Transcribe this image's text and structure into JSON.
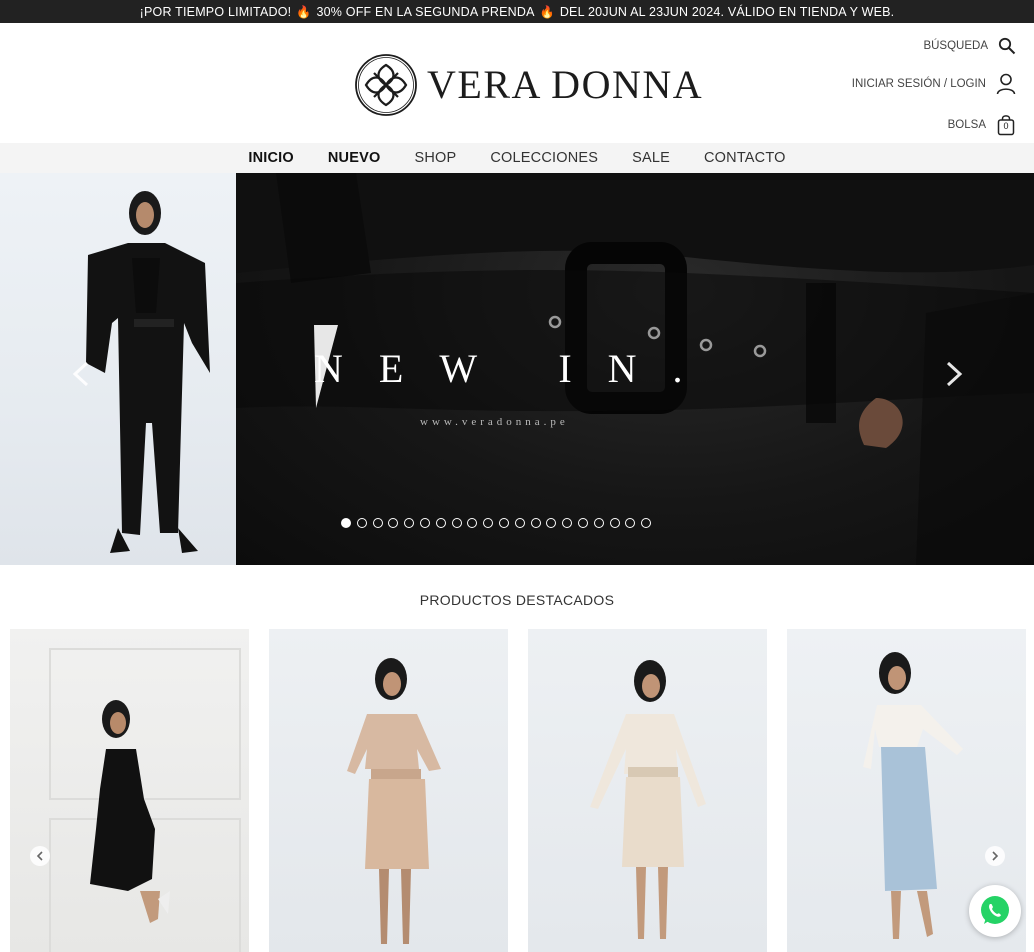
{
  "announcement": {
    "part1": "¡POR TIEMPO LIMITADO!",
    "part2": "30% OFF EN LA SEGUNDA PRENDA",
    "part3": "DEL 20JUN AL 23JUN 2024. VÁLIDO EN TIENDA Y WEB.",
    "flame_icon": "flame-icon",
    "flame_color": "#ff7a1a"
  },
  "header": {
    "brand": "VERA DONNA",
    "search_label": "BÚSQUEDA",
    "login_label": "INICIAR SESIÓN / LOGIN",
    "bag_label": "BOLSA",
    "bag_count": "0"
  },
  "nav": {
    "items": [
      {
        "label": "INICIO"
      },
      {
        "label": "NUEVO"
      },
      {
        "label": "SHOP"
      },
      {
        "label": "COLECCIONES"
      },
      {
        "label": "SALE"
      },
      {
        "label": "CONTACTO"
      }
    ]
  },
  "hero": {
    "title": "NEW IN.",
    "url": "www.veradonna.pe",
    "slide_count": 20,
    "active_slide": 1
  },
  "featured": {
    "title": "PRODUCTOS DESTACADOS",
    "products": [
      {
        "image": "black sleeveless midi dress"
      },
      {
        "image": "beige long-sleeve top with belted midi skirt"
      },
      {
        "image": "cream long-sleeve top with belted midi skirt"
      },
      {
        "image": "white long-sleeve crop top with light denim midi skirt"
      }
    ]
  },
  "colors": {
    "announce_bg": "#222222",
    "nav_bg": "#f4f4f4",
    "whatsapp": "#25d366"
  }
}
